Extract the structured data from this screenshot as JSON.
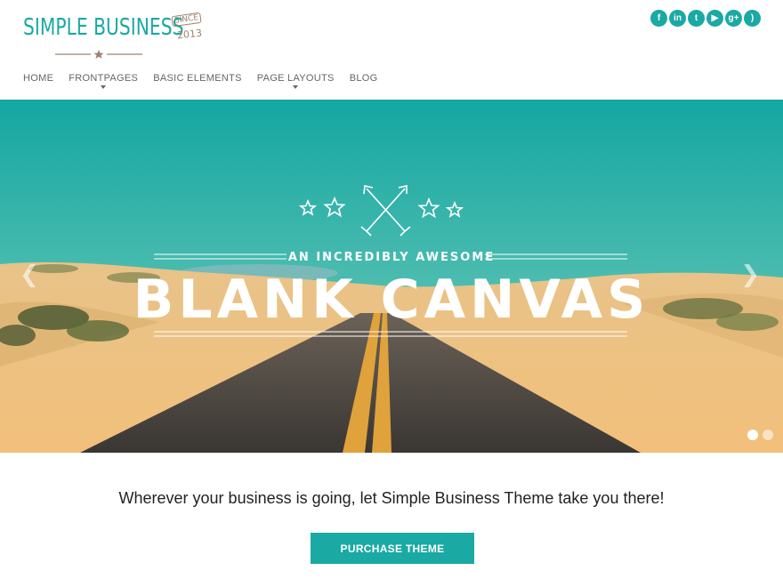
{
  "brand": {
    "name": "Simple Business",
    "since_top": "SINCE",
    "since_year": "2013",
    "accent_color": "#1aa9a3"
  },
  "social": [
    {
      "icon": "facebook-icon",
      "glyph": "f"
    },
    {
      "icon": "linkedin-icon",
      "glyph": "in"
    },
    {
      "icon": "twitter-icon",
      "glyph": "t"
    },
    {
      "icon": "youtube-icon",
      "glyph": "▶"
    },
    {
      "icon": "google-plus-icon",
      "glyph": "g+"
    },
    {
      "icon": "rss-icon",
      "glyph": ")"
    }
  ],
  "nav": {
    "items": [
      {
        "label": "HOME",
        "dropdown": false
      },
      {
        "label": "FRONTPAGES",
        "dropdown": true
      },
      {
        "label": "BASIC ELEMENTS",
        "dropdown": false
      },
      {
        "label": "PAGE LAYOUTS",
        "dropdown": true
      },
      {
        "label": "BLOG",
        "dropdown": false
      }
    ]
  },
  "hero": {
    "eyebrow": "AN INCREDIBLY AWESOME",
    "headline": "BLANK CANVAS",
    "prev_glyph": "❮",
    "next_glyph": "❯",
    "slides": 2,
    "active_slide": 1
  },
  "main": {
    "tagline": "Wherever your business is going, let Simple Business Theme take you there!",
    "cta_label": "PURCHASE THEME"
  }
}
